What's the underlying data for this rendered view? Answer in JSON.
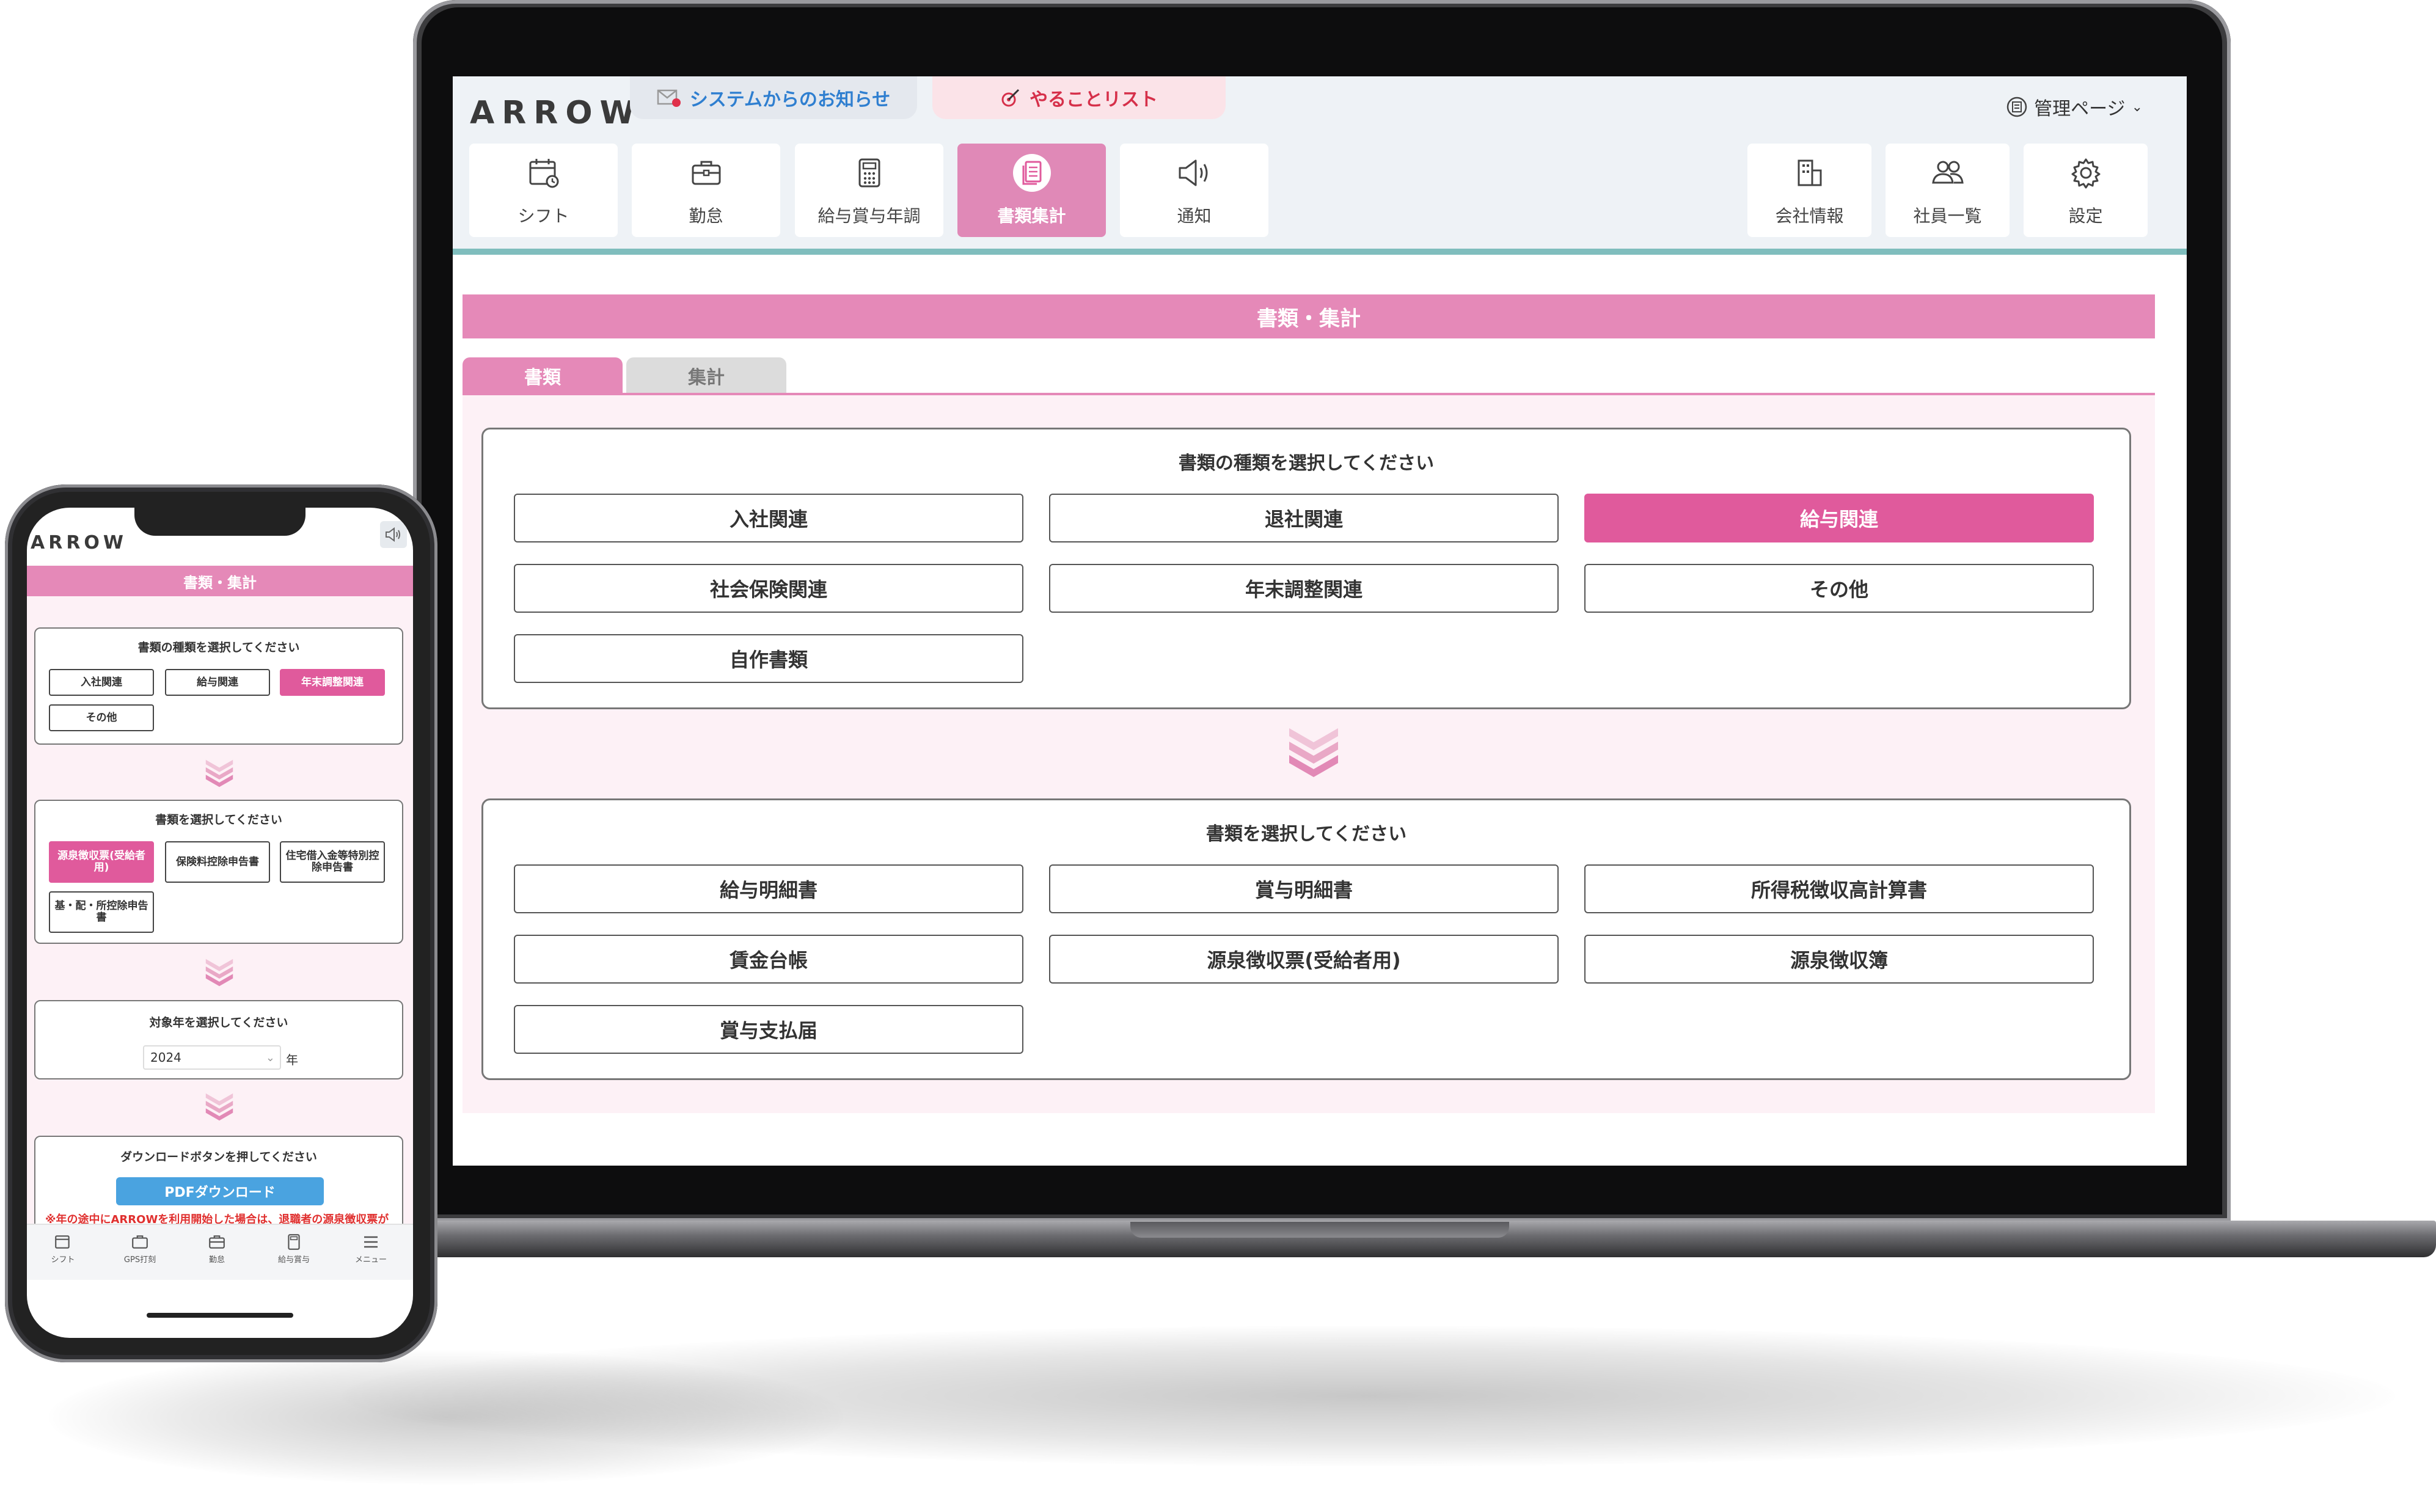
{
  "laptop": {
    "logo": "ARROW",
    "notices": {
      "system": "システムからのお知らせ",
      "todo": "やることリスト"
    },
    "admin_label": "管理ページ",
    "nav_left": [
      {
        "label": "シフト",
        "icon": "calendar-icon"
      },
      {
        "label": "勤怠",
        "icon": "briefcase-icon"
      },
      {
        "label": "給与賞与年調",
        "icon": "calculator-icon"
      },
      {
        "label": "書類集計",
        "icon": "document-icon",
        "active": true
      },
      {
        "label": "通知",
        "icon": "megaphone-icon"
      }
    ],
    "nav_right": [
      {
        "label": "会社情報",
        "icon": "building-icon"
      },
      {
        "label": "社員一覧",
        "icon": "users-icon"
      },
      {
        "label": "設定",
        "icon": "gear-icon"
      }
    ],
    "page_title": "書類・集計",
    "tabs": [
      "書類",
      "集計"
    ],
    "category_panel": {
      "title": "書類の種類を選択してください",
      "options": [
        "入社関連",
        "退社関連",
        "給与関連",
        "社会保険関連",
        "年末調整関連",
        "その他",
        "自作書類"
      ],
      "selected": "給与関連"
    },
    "document_panel": {
      "title": "書類を選択してください",
      "options": [
        "給与明細書",
        "賞与明細書",
        "所得税徴収高計算書",
        "賃金台帳",
        "源泉徴収票(受給者用)",
        "源泉徴収簿",
        "賞与支払届"
      ]
    }
  },
  "phone": {
    "logo": "ARROW",
    "page_title": "書類・集計",
    "category_panel": {
      "title": "書類の種類を選択してください",
      "options": [
        "入社関連",
        "給与関連",
        "年末調整関連",
        "その他"
      ],
      "selected": "年末調整関連"
    },
    "document_panel": {
      "title": "書類を選択してください",
      "options": [
        "源泉徴収票(受給者用)",
        "保険料控除申告書",
        "住宅借入金等特別控除申告書",
        "基・配・所控除申告書"
      ],
      "selected": "源泉徴収票(受給者用)"
    },
    "year_panel": {
      "title": "対象年を選択してください",
      "value": "2024",
      "unit": "年"
    },
    "download_panel": {
      "title": "ダウンロードボタンを押してください",
      "button": "PDFダウンロード",
      "warning": "※年の途中にARROWを利用開始した場合は、退職者の源泉徴収票が正しくない可能性があります"
    },
    "bottom_nav": [
      "シフト",
      "GPS打刻",
      "勤怠",
      "給与賞与",
      "メニュー"
    ]
  },
  "colors": {
    "accent_pink": "#e589b8",
    "selected_pink": "#e05a9c",
    "teal": "#7fbdbd",
    "download_blue": "#4aa3e0"
  }
}
